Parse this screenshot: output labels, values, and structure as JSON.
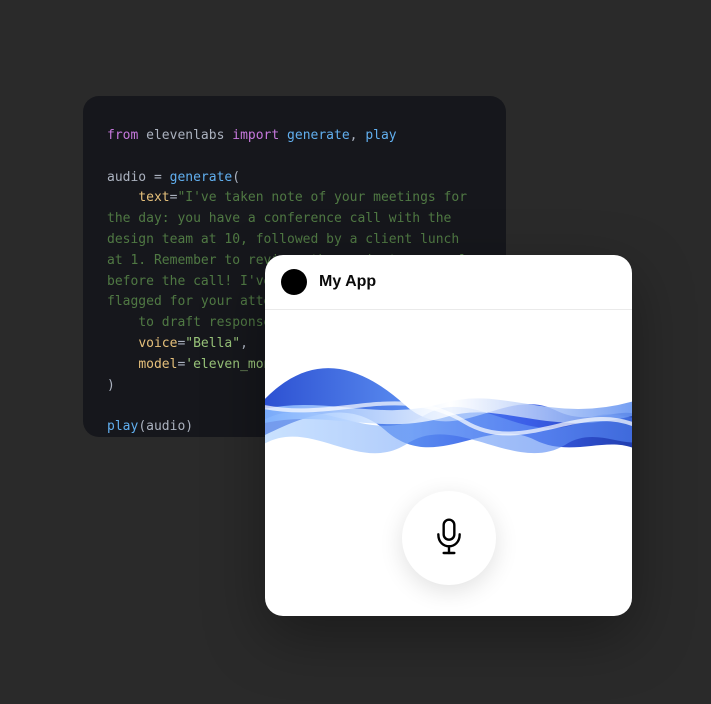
{
  "code": {
    "line1": {
      "from": "from",
      "module": "elevenlabs",
      "import": "import",
      "generate": "generate",
      "comma": ",",
      "play": "play"
    },
    "line2": {
      "audio": "audio",
      "eq": " = ",
      "generate": "generate",
      "open": "("
    },
    "text_param": "text",
    "text_eq": "=",
    "text_value": "\"I've taken note of your meetings for the day: you have a conference call with the design team at 10, followed by a client lunch at 1. Remember to review  the project proposal before the call! I've also seen few emails flagged for your attention in yo",
    "text_truncated": "to draft responses",
    "voice_param": "voice",
    "voice_eq": "=",
    "voice_value": "\"Bella\"",
    "voice_comma": ",",
    "model_param": "model",
    "model_eq": "=",
    "model_value": "'eleven_mono",
    "close_paren": ")",
    "play_call": {
      "play": "play",
      "open": "(",
      "audio": "audio",
      "close": ")"
    }
  },
  "app": {
    "title": "My App"
  },
  "colors": {
    "bg": "#2a2a2a",
    "code_bg": "#16171c",
    "wave_primary": "#3b5ee8",
    "wave_secondary": "#6a9ff5",
    "wave_light": "#a8d0ff"
  }
}
